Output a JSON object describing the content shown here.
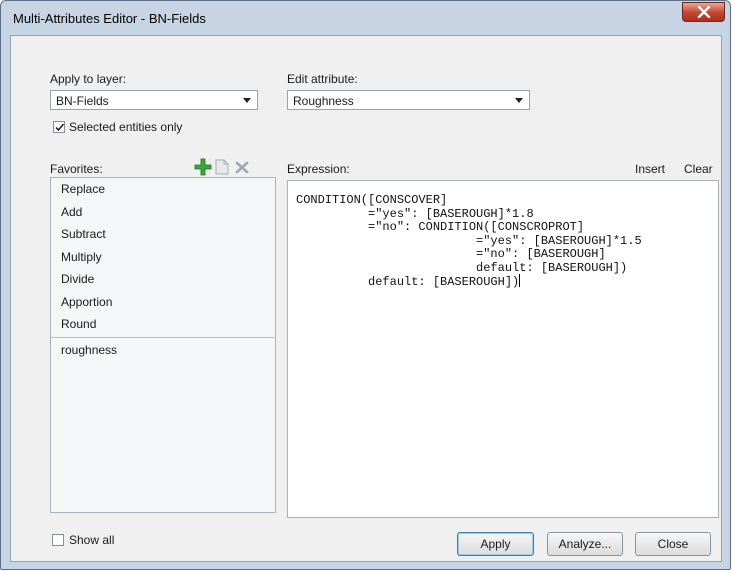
{
  "window": {
    "title": "Multi-Attributes Editor - BN-Fields"
  },
  "layer": {
    "label": "Apply to layer:",
    "value": "BN-Fields"
  },
  "attribute": {
    "label": "Edit attribute:",
    "value": "Roughness"
  },
  "selected_only": {
    "label": "Selected entities only",
    "checked": true
  },
  "favorites": {
    "label": "Favorites:",
    "items": [
      "Replace",
      "Add",
      "Subtract",
      "Multiply",
      "Divide",
      "Apportion",
      "Round"
    ],
    "custom_items": [
      "roughness"
    ]
  },
  "expression": {
    "label": "Expression:",
    "insert_label": "Insert",
    "clear_label": "Clear",
    "lines": [
      "CONDITION([CONSCOVER]",
      "          =\"yes\": [BASEROUGH]*1.8",
      "          =\"no\": CONDITION([CONSCROPROT]",
      "                         =\"yes\": [BASEROUGH]*1.5",
      "                         =\"no\": [BASEROUGH]",
      "                         default: [BASEROUGH])",
      "          default: [BASEROUGH])"
    ]
  },
  "show_all": {
    "label": "Show all",
    "checked": false
  },
  "buttons": {
    "apply": "Apply",
    "analyze": "Analyze...",
    "close": "Close"
  },
  "colors": {
    "accent": "#3c7fb1",
    "add_icon": "#3aa83a",
    "close_button": "#c64b36"
  }
}
